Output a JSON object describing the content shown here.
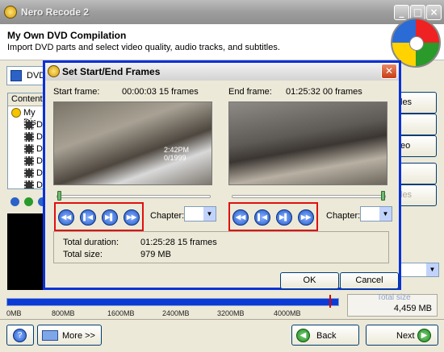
{
  "app": {
    "title": "Nero Recode 2"
  },
  "header": {
    "title": "My Own DVD Compilation",
    "subtitle": "Import DVD parts and select video quality, audio tracks, and subtitles."
  },
  "left": {
    "source_label": "DVD-",
    "tree_header": "Content",
    "root_item": "My Dis",
    "items": [
      "Di",
      "Di",
      "Di",
      "Di",
      "Di",
      "Di"
    ]
  },
  "right_buttons": [
    "les",
    "",
    "eo",
    "",
    "les"
  ],
  "total_size": {
    "label": "Total size",
    "value": "4,459 MB"
  },
  "scale": {
    "labels": [
      "0MB",
      "800MB",
      "1600MB",
      "2400MB",
      "3200MB",
      "4000MB"
    ],
    "fill_fraction": 1.0
  },
  "dialog": {
    "title": "Set Start/End Frames",
    "start": {
      "label": "Start frame:",
      "value": "00:00:03 15 frames",
      "video_text": "2:42PM\n0/1999",
      "chapter_label": "Chapter:",
      "chapter_value": ""
    },
    "end": {
      "label": "End frame:",
      "value": "01:25:32 00 frames",
      "chapter_label": "Chapter:",
      "chapter_value": ""
    },
    "info": {
      "duration_label": "Total duration:",
      "duration_value": "01:25:28 15 frames",
      "size_label": "Total size:",
      "size_value": "979 MB"
    },
    "ok_label": "OK",
    "cancel_label": "Cancel"
  },
  "bottom": {
    "help_label": "?",
    "more_label": "More >>",
    "back_label": "Back",
    "next_label": "Next"
  },
  "colors": {
    "dialog_border": "#0831d9",
    "highlight_red": "#e01010",
    "scale_fill": "#0a3bd6"
  },
  "icons": [
    "app-icon",
    "minimize-icon",
    "maximize-icon",
    "close-icon",
    "disc-icon",
    "film-icon",
    "rewind-icon",
    "step-back-icon",
    "step-forward-icon",
    "fast-forward-icon",
    "help-icon",
    "back-arrow-icon",
    "next-arrow-icon"
  ]
}
